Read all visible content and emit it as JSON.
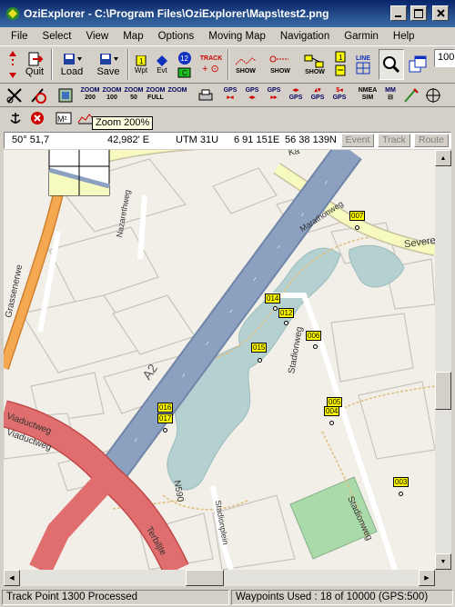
{
  "window": {
    "title": "OziExplorer - C:\\Program Files\\OziExplorer\\Maps\\test2.png"
  },
  "menu": [
    "File",
    "Select",
    "View",
    "Map",
    "Options",
    "Moving Map",
    "Navigation",
    "Garmin",
    "Help"
  ],
  "toolbar": {
    "quit_label": "Quit",
    "load_label": "Load",
    "save_label": "Save",
    "wpt_label": "Wpt",
    "evt_label": "Evt",
    "track_label": "TRACK",
    "show_label": "SHOW",
    "line_label": "LINE",
    "scale_value": "100"
  },
  "zoom_buttons": [
    {
      "top": "ZOOM",
      "bottom": "200"
    },
    {
      "top": "ZOOM",
      "bottom": "100"
    },
    {
      "top": "ZOOM",
      "bottom": "50"
    },
    {
      "top": "ZOOM",
      "bottom": "FULL"
    },
    {
      "top": "ZOOM",
      "bottom": ""
    }
  ],
  "gps_label": "GPS",
  "nmea_label": "NMEA SIM",
  "mm_label": "MM",
  "tooltip": "Zoom 200%",
  "coords": {
    "lat": "50° 51,7",
    "lon": "42,982' E",
    "utm_zone": "UTM  31U",
    "easting": "6 91 151E",
    "northing": "56 38 139N",
    "btn_event": "Event",
    "btn_track": "Track",
    "btn_route": "Route"
  },
  "map": {
    "streets": [
      "Marathonweg",
      "Severe",
      "Nazarethweg",
      "Stadionweg",
      "Stadionweg",
      "Stadionplein",
      "Viaductweg",
      "Viaductweg",
      "Terbiljte",
      "Grassenerwe",
      "A2",
      "N590"
    ],
    "waypoints": [
      "007",
      "014",
      "012",
      "006",
      "015",
      "005",
      "004",
      "016",
      "017",
      "003"
    ]
  },
  "colors": {
    "water": "#b5d0d0",
    "motorway": "#8ca0c0",
    "primary": "#e06e6e",
    "secondary": "#f6fabe",
    "park": "#aadaaa",
    "titlebar": "#0a246a"
  },
  "status": {
    "left": "Track Point 1300 Processed",
    "right": "Waypoints Used : 18 of 10000  (GPS:500)"
  }
}
